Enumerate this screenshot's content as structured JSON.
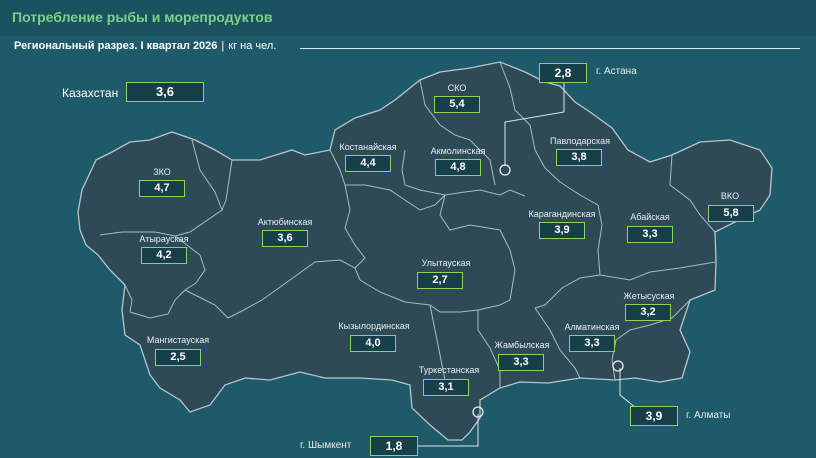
{
  "header": {
    "title": "Потребление рыбы и морепродуктов",
    "subtitle": "Региональный разрез. I квартал 2026",
    "separator": "|",
    "unit": "кг на чел."
  },
  "country": {
    "label": "Казахстан",
    "value": "3,6"
  },
  "regions": {
    "sko": {
      "label": "СКО",
      "value": "5,4"
    },
    "kostanay": {
      "label": "Костанайская",
      "value": "4,4"
    },
    "akmola": {
      "label": "Акмолинская",
      "value": "4,8"
    },
    "pavlodar": {
      "label": "Павлодарская",
      "value": "3,8"
    },
    "zko": {
      "label": "ЗКО",
      "value": "4,7"
    },
    "atyrau": {
      "label": "Атырауская",
      "value": "4,2"
    },
    "aktobe": {
      "label": "Актюбинская",
      "value": "3,6"
    },
    "karaganda": {
      "label": "Карагандинская",
      "value": "3,9"
    },
    "abay": {
      "label": "Абайская",
      "value": "3,3"
    },
    "vko": {
      "label": "ВКО",
      "value": "5,8"
    },
    "ulytau": {
      "label": "Улытауская",
      "value": "2,7"
    },
    "zhetysu": {
      "label": "Жетысуская",
      "value": "3,2"
    },
    "kyzylorda": {
      "label": "Кызылординская",
      "value": "4,0"
    },
    "almaty_reg": {
      "label": "Алматинская",
      "value": "3,3"
    },
    "mangystau": {
      "label": "Мангистауская",
      "value": "2,5"
    },
    "zhambyl": {
      "label": "Жамбылская",
      "value": "3,3"
    },
    "turkestan": {
      "label": "Туркестанская",
      "value": "3,1"
    }
  },
  "cities": {
    "astana": {
      "label": "г. Астана",
      "value": "2,8"
    },
    "almaty": {
      "label": "г. Алматы",
      "value": "3,9"
    },
    "shymkent": {
      "label": "г. Шымкент",
      "value": "1,8"
    }
  },
  "colors": {
    "background": "#1f5a6a",
    "map_fill": "#2e4a57",
    "borders": "#9fb3ba",
    "value_border": "#8fd35a",
    "title": "#7fd08a"
  }
}
